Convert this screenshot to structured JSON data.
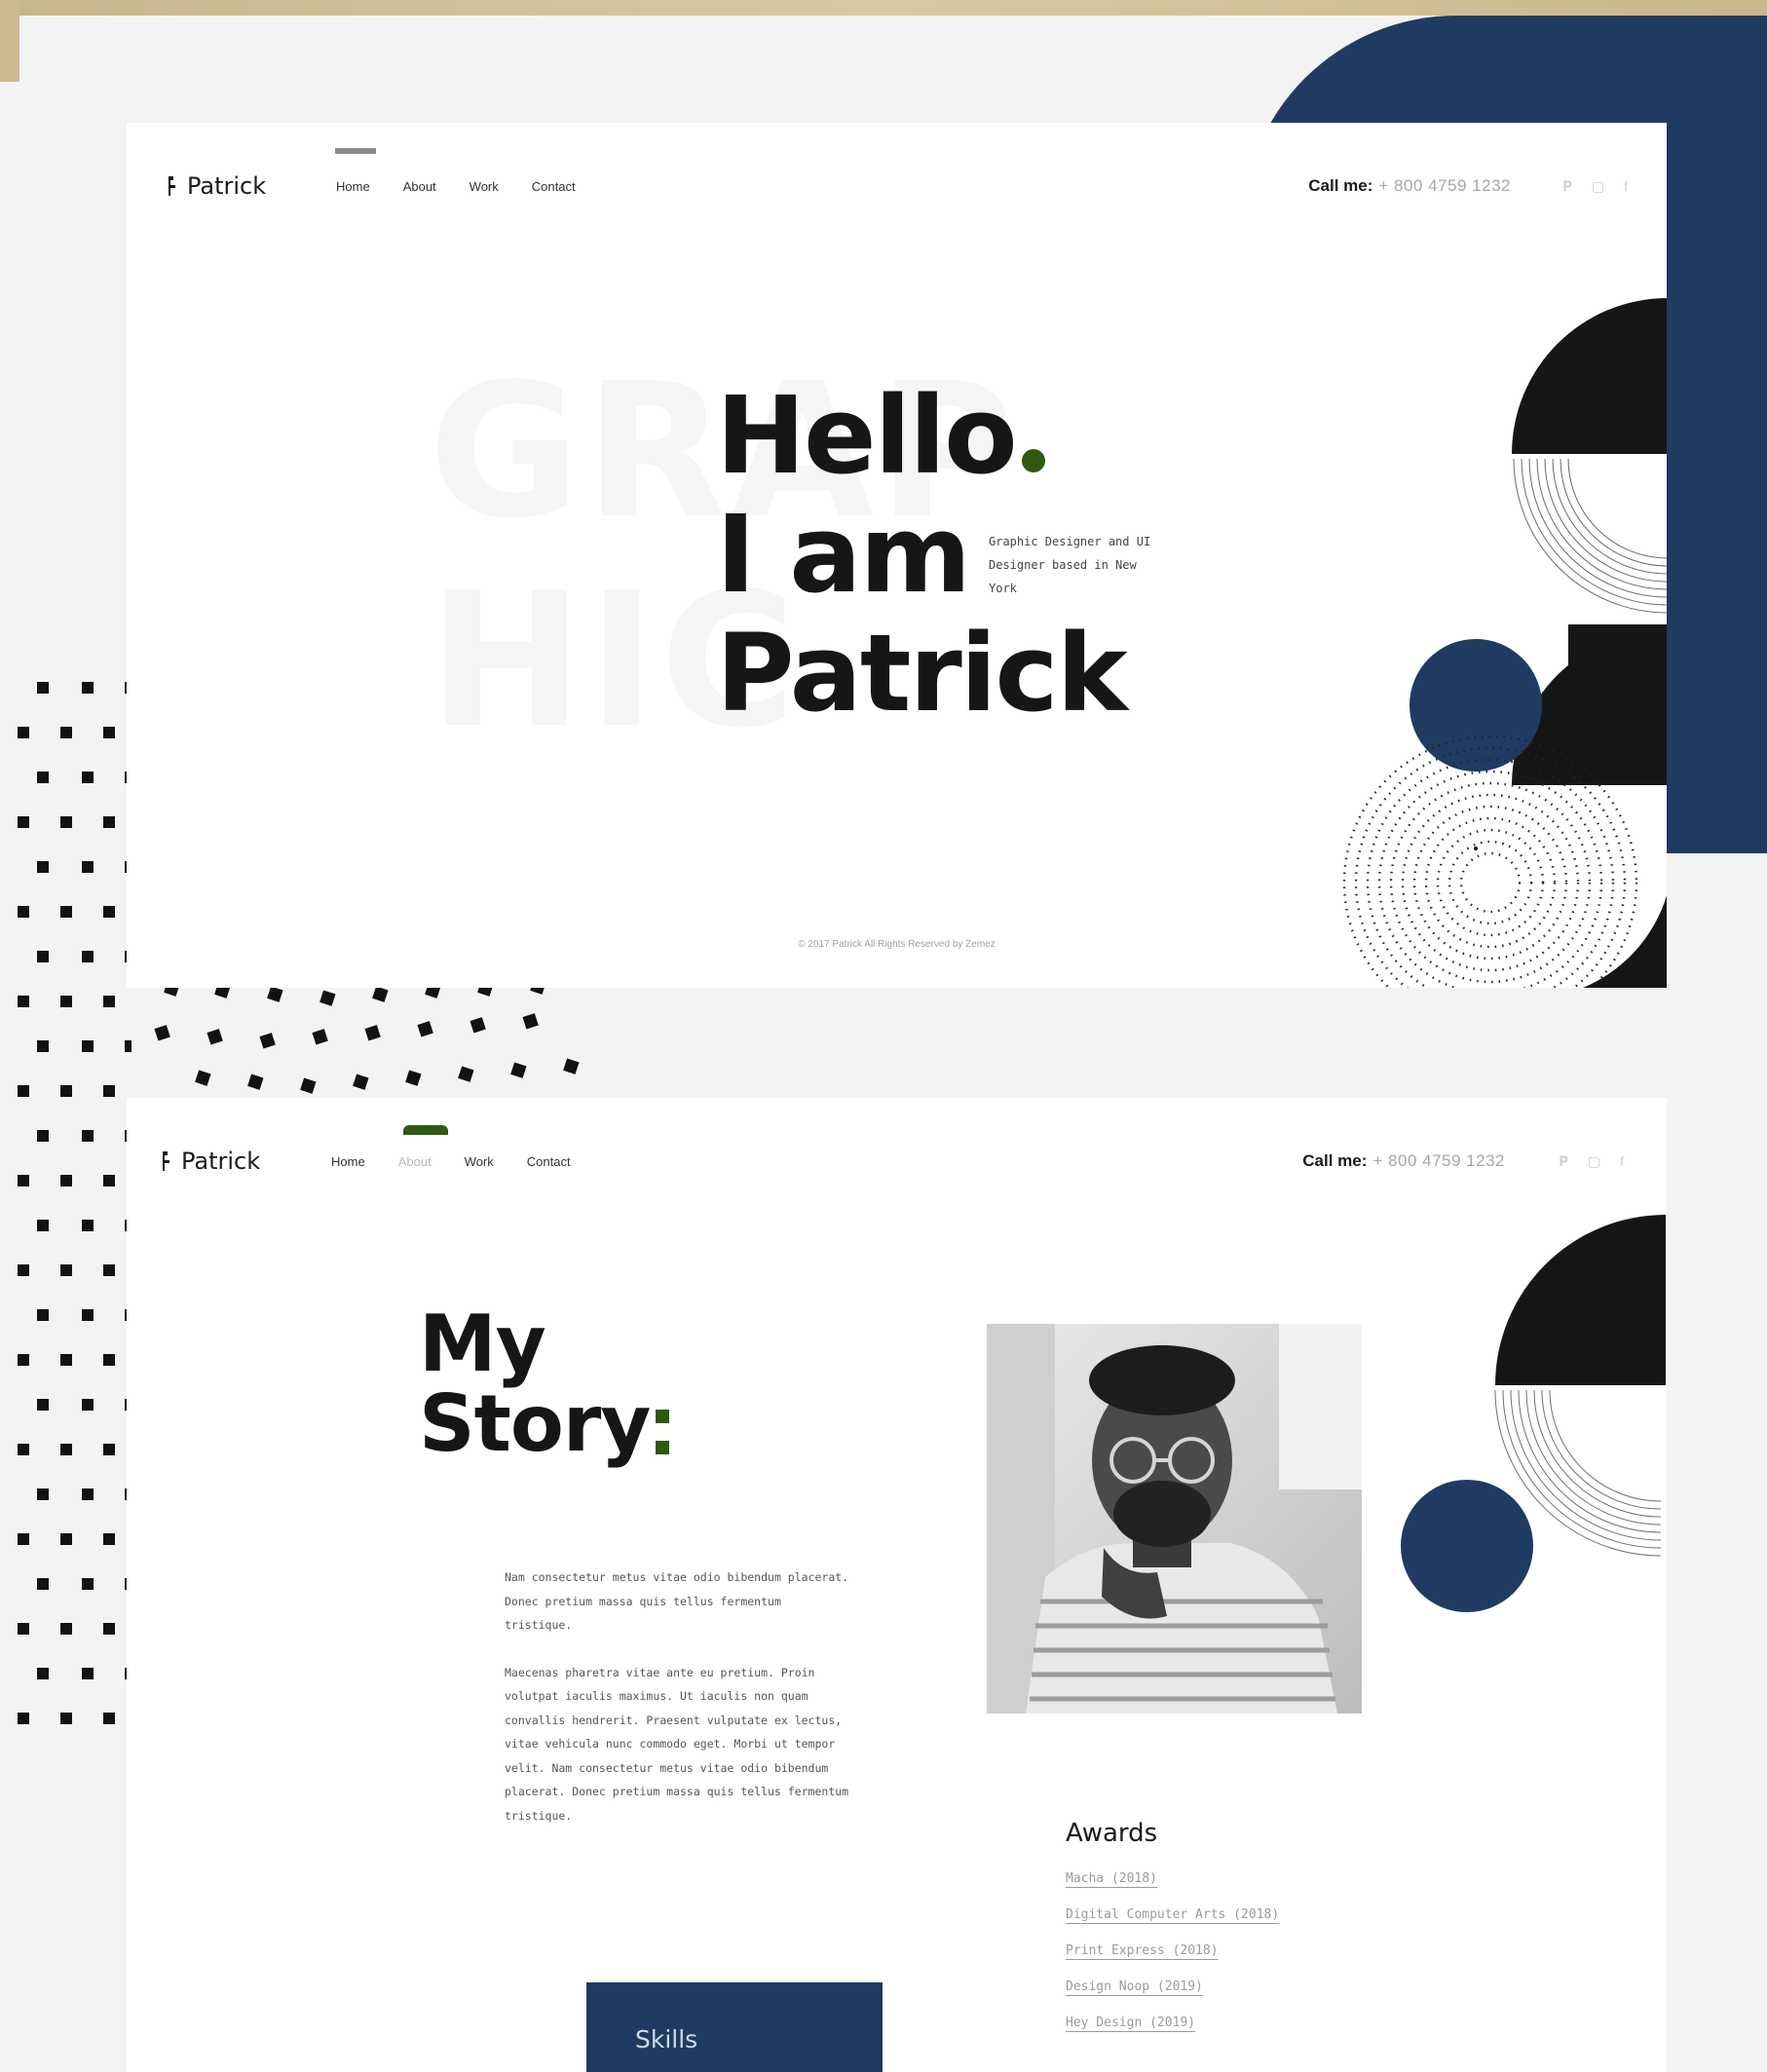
{
  "brand": {
    "name": "Patrick"
  },
  "nav": {
    "items": [
      {
        "label": "Home"
      },
      {
        "label": "About"
      },
      {
        "label": "Work"
      },
      {
        "label": "Contact"
      }
    ]
  },
  "contact": {
    "label": "Call me:",
    "phone": "+ 800 4759 1232"
  },
  "socials": [
    "pinterest-icon",
    "instagram-icon",
    "facebook-icon"
  ],
  "hero": {
    "ghost_top": "GRAP",
    "ghost_bottom": "HIC",
    "line1": "Hello",
    "line2": "I am",
    "line3": "Patrick",
    "subtitle": "Graphic Designer and UI Designer based in New York",
    "copyright": "© 2017 Patrick All Rights Reserved by Zemez"
  },
  "story": {
    "title_line1": "My",
    "title_line2": "Story",
    "paragraph1": "Nam consectetur metus vitae odio bibendum placerat. Donec pretium massa quis tellus fermentum tristique.",
    "paragraph2": "Maecenas pharetra vitae ante eu pretium. Proin volutpat iaculis maximus. Ut iaculis non quam convallis hendrerit. Praesent vulputate ex lectus, vitae vehicula nunc commodo eget. Morbi ut tempor velit. Nam consectetur metus vitae odio bibendum placerat. Donec pretium massa quis tellus fermentum tristique.",
    "awards_title": "Awards",
    "awards": [
      "Macha (2018)",
      "Digital Computer Arts (2018)",
      "Print Express (2018)",
      "Design Noop (2019)",
      "Hey Design (2019)"
    ],
    "skills_label": "Skills"
  },
  "colors": {
    "navy": "#1f3b62",
    "green": "#2d5a0e",
    "gold": "#cdbb92"
  }
}
